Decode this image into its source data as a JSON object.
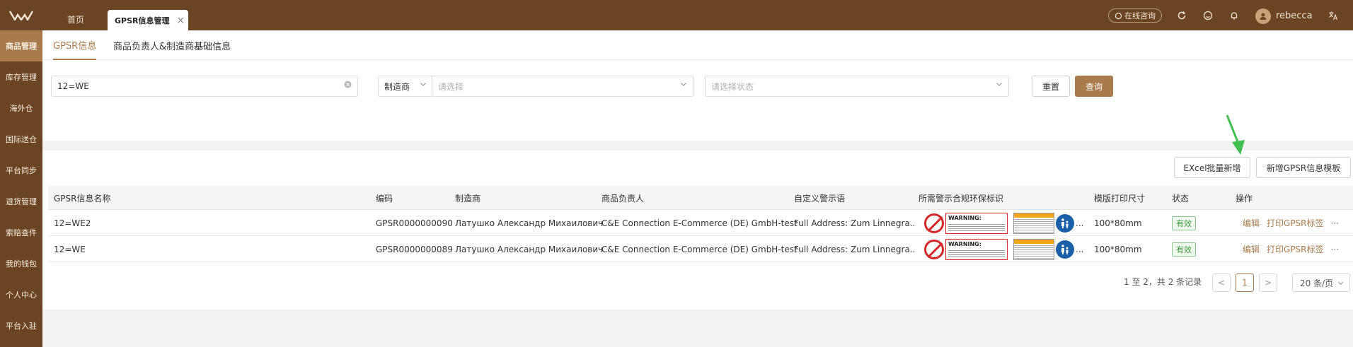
{
  "topbar": {
    "home_tab": "首页",
    "active_tab": "GPSR信息管理",
    "close_glyph": "×",
    "online_consult": "在线咨询",
    "username": "rebecca",
    "brand_color": "#6b4423"
  },
  "sidebar": {
    "items": [
      {
        "label": "商品管理"
      },
      {
        "label": "库存管理"
      },
      {
        "label": "海外仓"
      },
      {
        "label": "国际送仓"
      },
      {
        "label": "平台同步"
      },
      {
        "label": "退货管理"
      },
      {
        "label": "索赔查件"
      },
      {
        "label": "我的钱包"
      },
      {
        "label": "个人中心"
      },
      {
        "label": "平台入驻"
      }
    ]
  },
  "subtabs": {
    "tab1": "GPSR信息",
    "tab2": "商品负责人&制造商基础信息"
  },
  "filter": {
    "search_value": "12=WE",
    "manufacturer_label": "制造商",
    "manufacturer_placeholder": "请选择",
    "status_placeholder": "请选择状态",
    "reset": "重置",
    "query": "查询"
  },
  "toolbar": {
    "excel_add": "EXcel批量新增",
    "add_template": "新增GPSR信息模板"
  },
  "table": {
    "headers": {
      "name": "GPSR信息名称",
      "code": "编码",
      "manufacturer": "制造商",
      "responsible": "商品负责人",
      "warning": "自定义警示语",
      "labels": "所需警示合规环保标识",
      "size": "模版打印尺寸",
      "status": "状态",
      "ops": "操作"
    },
    "rows": [
      {
        "name": "12=WE2",
        "code": "GPSR0000000090",
        "manufacturer": "Латушко Александр Михаилович",
        "responsible": "C&E Connection E-Commerce (DE) GmbH-test",
        "warning": "Full Address: Zum Linnegra...",
        "size": "100*80mm",
        "status": "有效",
        "edit": "编辑",
        "print": "打印GPSR标签",
        "more": "···"
      },
      {
        "name": "12=WE",
        "code": "GPSR0000000089",
        "manufacturer": "Латушко Александр Михаилович",
        "responsible": "C&E Connection E-Commerce (DE) GmbH-test",
        "warning": "Full Address: Zum Linnegra...",
        "size": "100*80mm",
        "status": "有效",
        "edit": "编辑",
        "print": "打印GPSR标签",
        "more": "···"
      }
    ],
    "warning_label_text": "WARNING:",
    "ellipsis": "..."
  },
  "pagination": {
    "summary": "1 至 2，共 2 条记录",
    "prev": "<",
    "current": "1",
    "next": ">",
    "page_size": "20 条/页"
  }
}
